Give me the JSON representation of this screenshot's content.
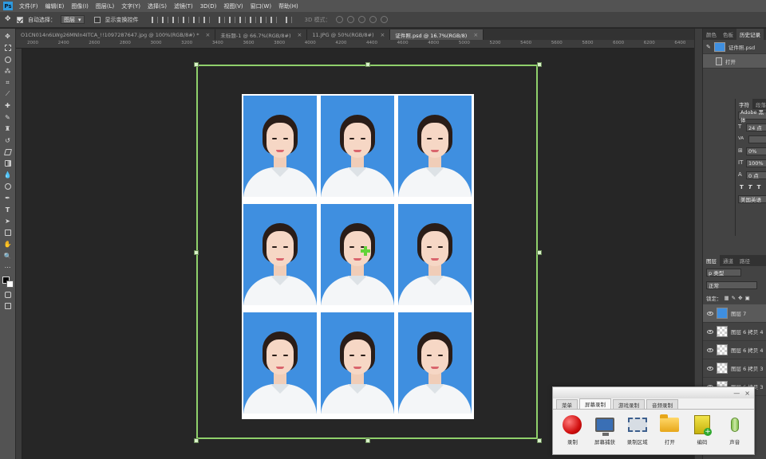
{
  "menubar": {
    "logo": "Ps",
    "items": [
      "文件(F)",
      "编辑(E)",
      "图像(I)",
      "图层(L)",
      "文字(Y)",
      "选择(S)",
      "滤镜(T)",
      "3D(D)",
      "视图(V)",
      "窗口(W)",
      "帮助(H)"
    ]
  },
  "options": {
    "auto_select_label": "自动选择：",
    "auto_select_value": "图层",
    "show_transform_label": "显示变换控件",
    "mode_label": "3D 模式："
  },
  "tabs": [
    {
      "label": "O1CN014n6LWg26MNln4ITCA_!!1097287647.jpg @ 100%(RGB/8#) *",
      "close": "×"
    },
    {
      "label": "未标题-1 @ 66.7%(RGB/8#)",
      "close": "×"
    },
    {
      "label": "11.JPG @ 50%(RGB/8#)",
      "close": "×"
    },
    {
      "label": "证件照.psd @ 16.7%(RGB/8)",
      "close": "×"
    }
  ],
  "ruler": {
    "ticks": [
      "2000",
      "2400",
      "2600",
      "2800",
      "3000",
      "3200",
      "3400",
      "3600",
      "3800",
      "4000",
      "4200",
      "4400",
      "4600",
      "4800",
      "5000",
      "5200",
      "5400",
      "5600",
      "5800",
      "6000",
      "6200",
      "6400"
    ]
  },
  "right_panel": {
    "top_tabs": [
      "颜色",
      "色板",
      "历史记录"
    ],
    "history": [
      {
        "label": "证件照.psd"
      },
      {
        "label": "打开"
      }
    ],
    "char_tabs": [
      "字符",
      "段落"
    ],
    "char": {
      "font": "Adobe 黑体",
      "size": "24 点",
      "kerning": "VA",
      "tracking": "0%",
      "scale": "100%",
      "baseline": "0 点",
      "style_buttons": [
        "T",
        "T",
        "T"
      ],
      "language": "美国英语"
    },
    "layers_tabs": [
      "图层",
      "通道",
      "路径"
    ],
    "layers_filter": "p 类型",
    "blend_mode": "正常",
    "lock_label": "锁定：",
    "layers": [
      {
        "name": "图层 7"
      },
      {
        "name": "图层 6 拷贝 4"
      },
      {
        "name": "图层 6 拷贝 4"
      },
      {
        "name": "图层 6 拷贝 3"
      },
      {
        "name": "图层 6 拷贝 3"
      }
    ]
  },
  "recorder": {
    "controls": [
      "—",
      "×"
    ],
    "tabs": [
      "菜单",
      "屏幕录制",
      "游戏录制",
      "音频录制"
    ],
    "buttons": [
      {
        "label": "录制",
        "icon": "record-icon"
      },
      {
        "label": "屏幕捕获",
        "icon": "monitor-icon"
      },
      {
        "label": "录制区域",
        "icon": "region-icon"
      },
      {
        "label": "打开",
        "icon": "folder-icon"
      },
      {
        "label": "编码",
        "icon": "encode-icon"
      },
      {
        "label": "声音",
        "icon": "microphone-icon"
      }
    ]
  },
  "colors": {
    "accent_transform": "#8fd06b",
    "photo_background": "#3f8fe0",
    "cursor": "#63d33a"
  }
}
